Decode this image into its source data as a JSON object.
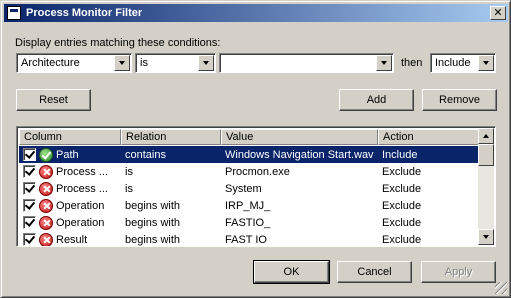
{
  "window": {
    "title": "Process Monitor Filter",
    "close_glyph": "✕"
  },
  "filter": {
    "prompt": "Display entries matching these conditions:",
    "column_value": "Architecture",
    "relation_value": "is",
    "value_text": "",
    "then_label": "then",
    "action_value": "Include"
  },
  "buttons": {
    "reset": "Reset",
    "add": "Add",
    "remove": "Remove",
    "ok": "OK",
    "cancel": "Cancel",
    "apply": "Apply"
  },
  "list": {
    "headers": [
      "Column",
      "Relation",
      "Value",
      "Action"
    ],
    "rows": [
      {
        "column": "Path",
        "relation": "contains",
        "value": "Windows Navigation Start.wav",
        "action": "Include",
        "icon": "include-icon",
        "checked": true,
        "selected": true
      },
      {
        "column": "Process ...",
        "relation": "is",
        "value": "Procmon.exe",
        "action": "Exclude",
        "icon": "exclude-icon",
        "checked": true,
        "selected": false
      },
      {
        "column": "Process ...",
        "relation": "is",
        "value": "System",
        "action": "Exclude",
        "icon": "exclude-icon",
        "checked": true,
        "selected": false
      },
      {
        "column": "Operation",
        "relation": "begins with",
        "value": "IRP_MJ_",
        "action": "Exclude",
        "icon": "exclude-icon",
        "checked": true,
        "selected": false
      },
      {
        "column": "Operation",
        "relation": "begins with",
        "value": "FASTIO_",
        "action": "Exclude",
        "icon": "exclude-icon",
        "checked": true,
        "selected": false
      },
      {
        "column": "Result",
        "relation": "begins with",
        "value": "FAST IO",
        "action": "Exclude",
        "icon": "exclude-icon",
        "checked": true,
        "selected": false
      }
    ]
  },
  "colors": {
    "selection": "#0a246a",
    "face": "#d4d0c8",
    "include": "#2e8b2e",
    "exclude": "#c01010"
  }
}
